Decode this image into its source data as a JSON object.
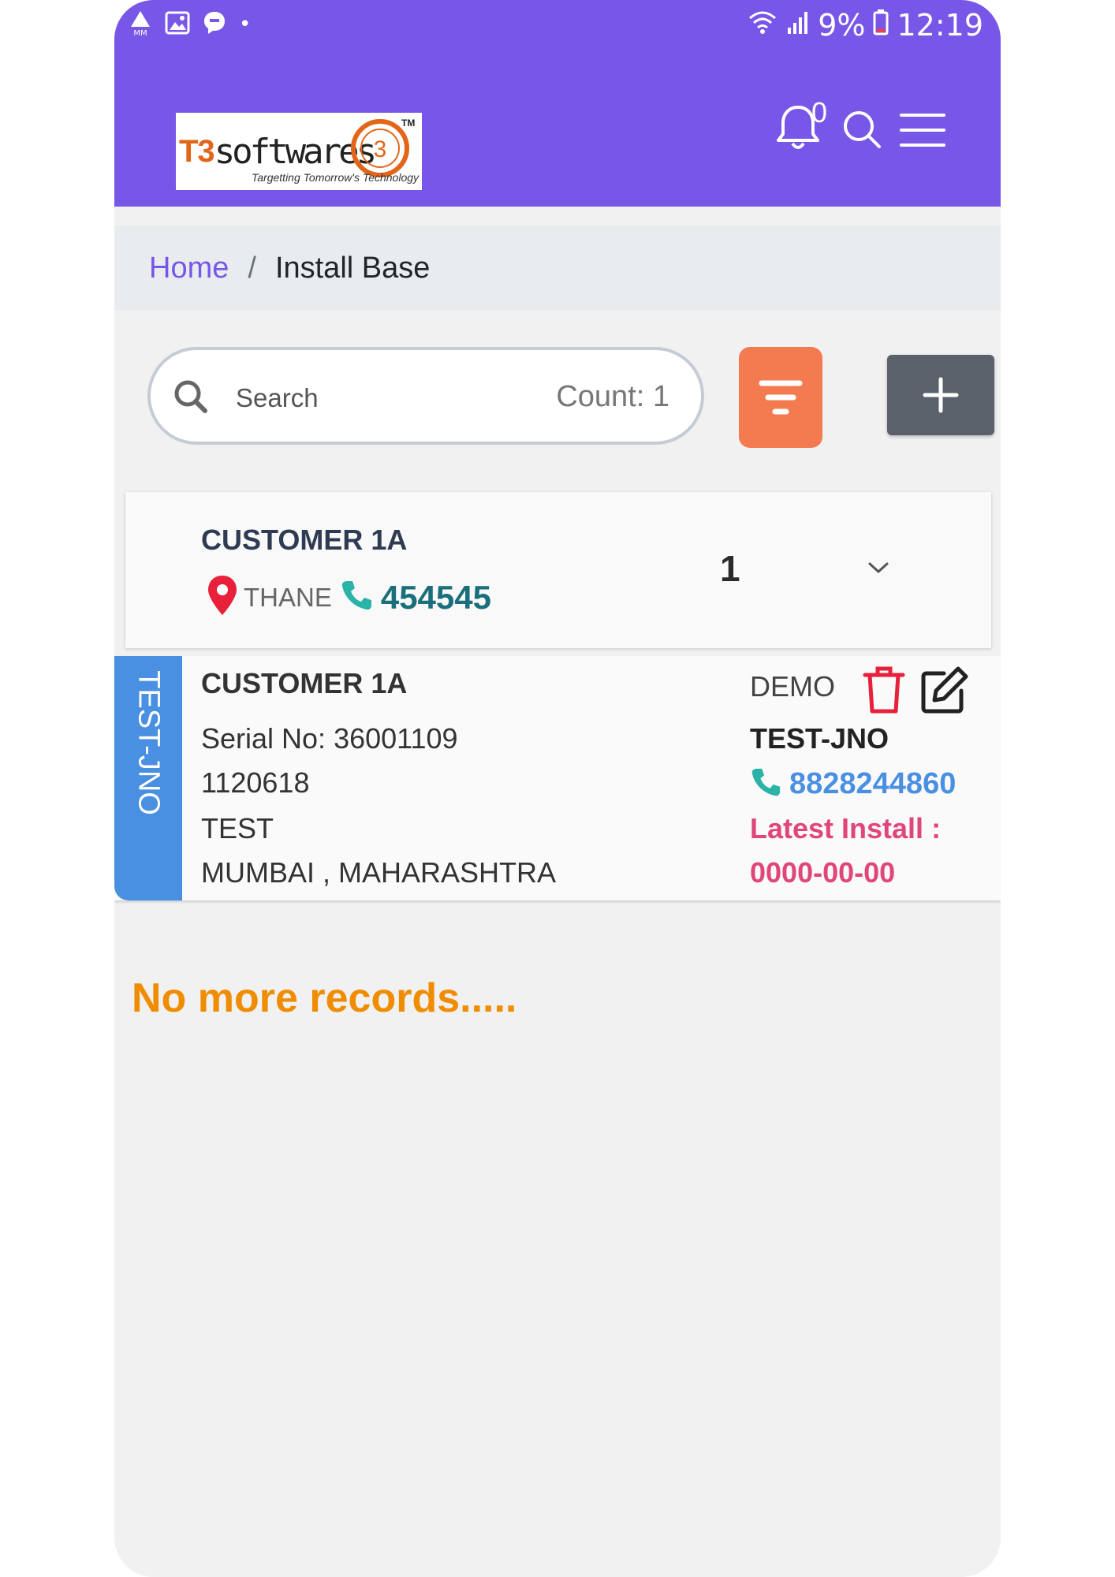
{
  "status_bar": {
    "battery": "9%",
    "time": "12:19",
    "dot": "•",
    "icons": [
      "mm-signal-icon",
      "image-icon",
      "messenger-icon",
      "wifi-icon",
      "signal-icon",
      "battery-icon"
    ]
  },
  "header": {
    "logo": {
      "t3": "T3",
      "softwares": "softwares",
      "ring_number": "3",
      "tm": "TM",
      "tagline": "Targetting Tomorrow's Technology"
    },
    "notification_count": "0",
    "icons": [
      "bell-icon",
      "search-icon",
      "menu-icon"
    ],
    "accent_color": "#7856e8"
  },
  "breadcrumb": {
    "home": "Home",
    "separator": "/",
    "current": "Install Base"
  },
  "search": {
    "placeholder": "Search",
    "count": "Count: 1"
  },
  "buttons": {
    "filter_color": "#f47b4f",
    "add_color": "#5a616b"
  },
  "customer_group": {
    "name": "CUSTOMER 1A",
    "city": "THANE",
    "phone": "454545",
    "count": "1"
  },
  "install_record": {
    "side_label": "TEST-JNO",
    "customer": "CUSTOMER 1A",
    "serial": "Serial No: 36001109",
    "code": "1120618",
    "product": "TEST",
    "location": "MUMBAI , MAHARASHTRA",
    "type": "DEMO",
    "engineer": "TEST-JNO",
    "phone": "8828244860",
    "latest_install_label": "Latest Install :",
    "latest_install_date": "0000-00-00"
  },
  "footer_message": "No more records....."
}
